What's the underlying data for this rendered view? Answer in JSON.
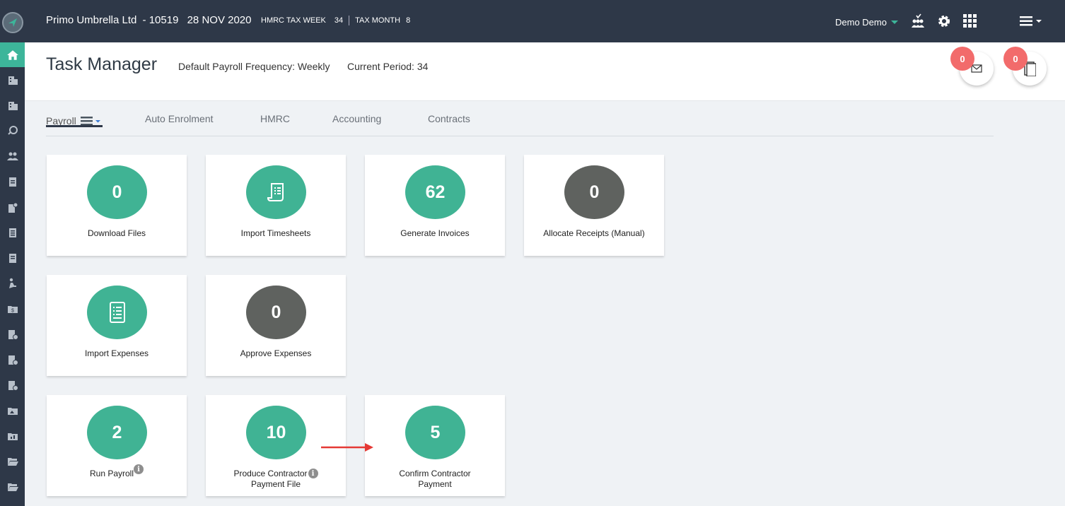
{
  "topbar": {
    "company": "Primo Umbrella Ltd",
    "company_id": "- 10519",
    "date": "28 NOV 2020",
    "hmrc_tax_week_label": "HMRC TAX WEEK",
    "hmrc_tax_week_value": "34",
    "tax_month_label": "TAX MONTH",
    "tax_month_value": "8",
    "user": "Demo Demo",
    "icons": [
      "approvals-icon",
      "gear-icon",
      "apps-grid-icon",
      "menu-icon"
    ]
  },
  "sidebar": {
    "icons": [
      "logo-icon",
      "home-icon",
      "building-icon",
      "building-alt-icon",
      "support-24-icon",
      "users-icon",
      "clipboard-icon",
      "document-settings-icon",
      "document-icon",
      "document-list-icon",
      "worker-icon",
      "money-folder-icon",
      "document-info-icon",
      "document-info-alt-icon",
      "document-info-alt2-icon",
      "folder-image-icon",
      "folder-chart-icon",
      "folder-open-icon",
      "folder-open-alt-icon"
    ]
  },
  "header": {
    "title": "Task Manager",
    "frequency": "Default Payroll Frequency: Weekly",
    "period": "Current Period: 34",
    "mail_badge": "0",
    "docs_badge": "0"
  },
  "tabs": [
    "Payroll",
    "Auto Enrolment",
    "HMRC",
    "Accounting",
    "Contracts"
  ],
  "cards": {
    "download_files": {
      "count": "0",
      "label": "Download Files"
    },
    "import_timesheets": {
      "label": "Import Timesheets"
    },
    "generate_invoices": {
      "count": "62",
      "label": "Generate Invoices"
    },
    "allocate_receipts": {
      "count": "0",
      "label": "Allocate Receipts (Manual)"
    },
    "import_expenses": {
      "label": "Import Expenses"
    },
    "approve_expenses": {
      "count": "0",
      "label": "Approve Expenses"
    },
    "run_payroll": {
      "count": "2",
      "label": "Run Payroll"
    },
    "produce_payment_file": {
      "count": "10",
      "label_line1": "Produce Contractor",
      "label_line2": "Payment File"
    },
    "confirm_payment": {
      "count": "5",
      "label_line1": "Confirm Contractor",
      "label_line2": "Payment"
    }
  },
  "colors": {
    "teal": "#40b394",
    "grey": "#5f625f",
    "badge": "#f26b6b",
    "nav": "#2e3848",
    "annotation_arrow": "#e53935"
  }
}
